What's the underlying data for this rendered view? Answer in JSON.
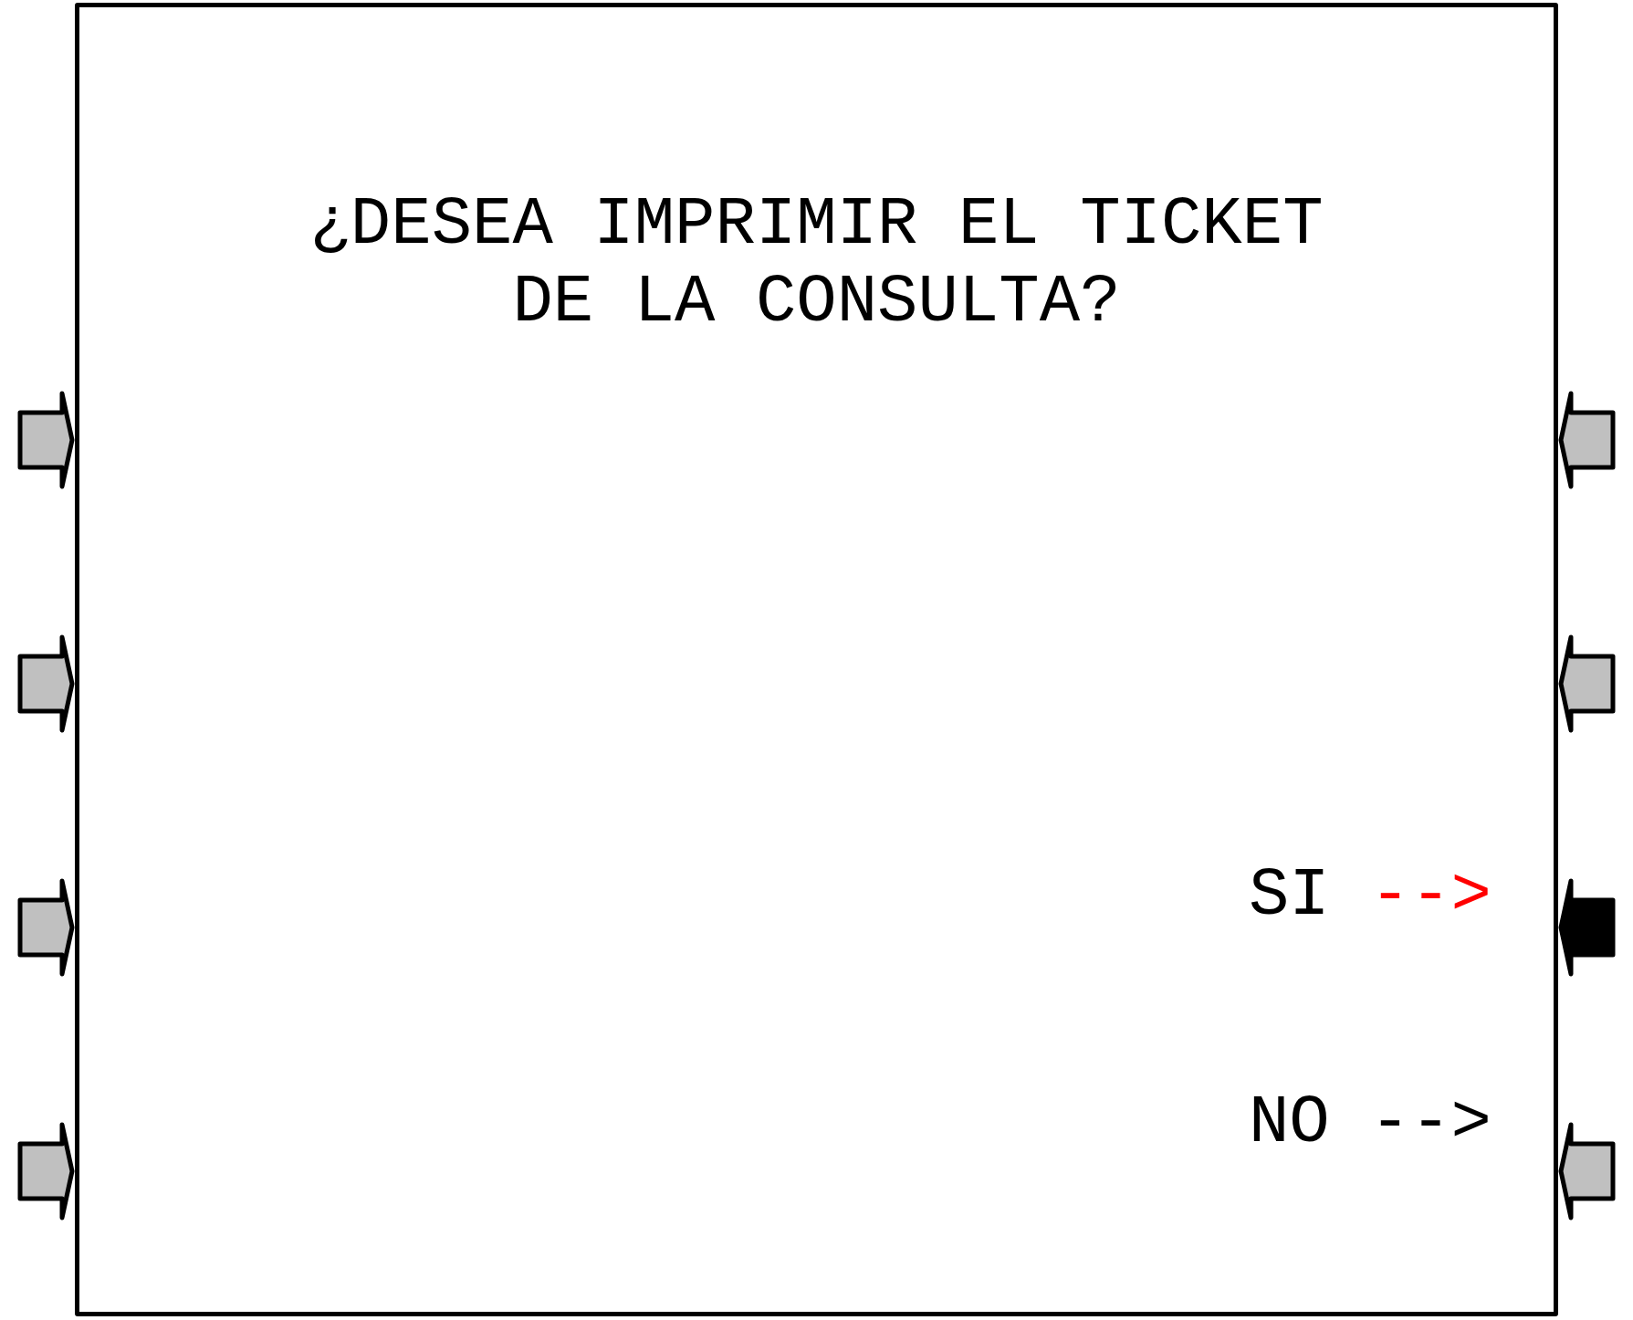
{
  "screen": {
    "prompt": "¿DESEA IMPRIMIR EL TICKET DE LA CONSULTA?"
  },
  "left_keys": [
    {
      "selected": false
    },
    {
      "selected": false
    },
    {
      "selected": false
    },
    {
      "selected": false
    }
  ],
  "right_keys": [
    {
      "selected": false
    },
    {
      "selected": false
    },
    {
      "selected": true,
      "label": "SI",
      "arrow": "-->"
    },
    {
      "selected": false,
      "label": "NO",
      "arrow": "-->"
    }
  ]
}
